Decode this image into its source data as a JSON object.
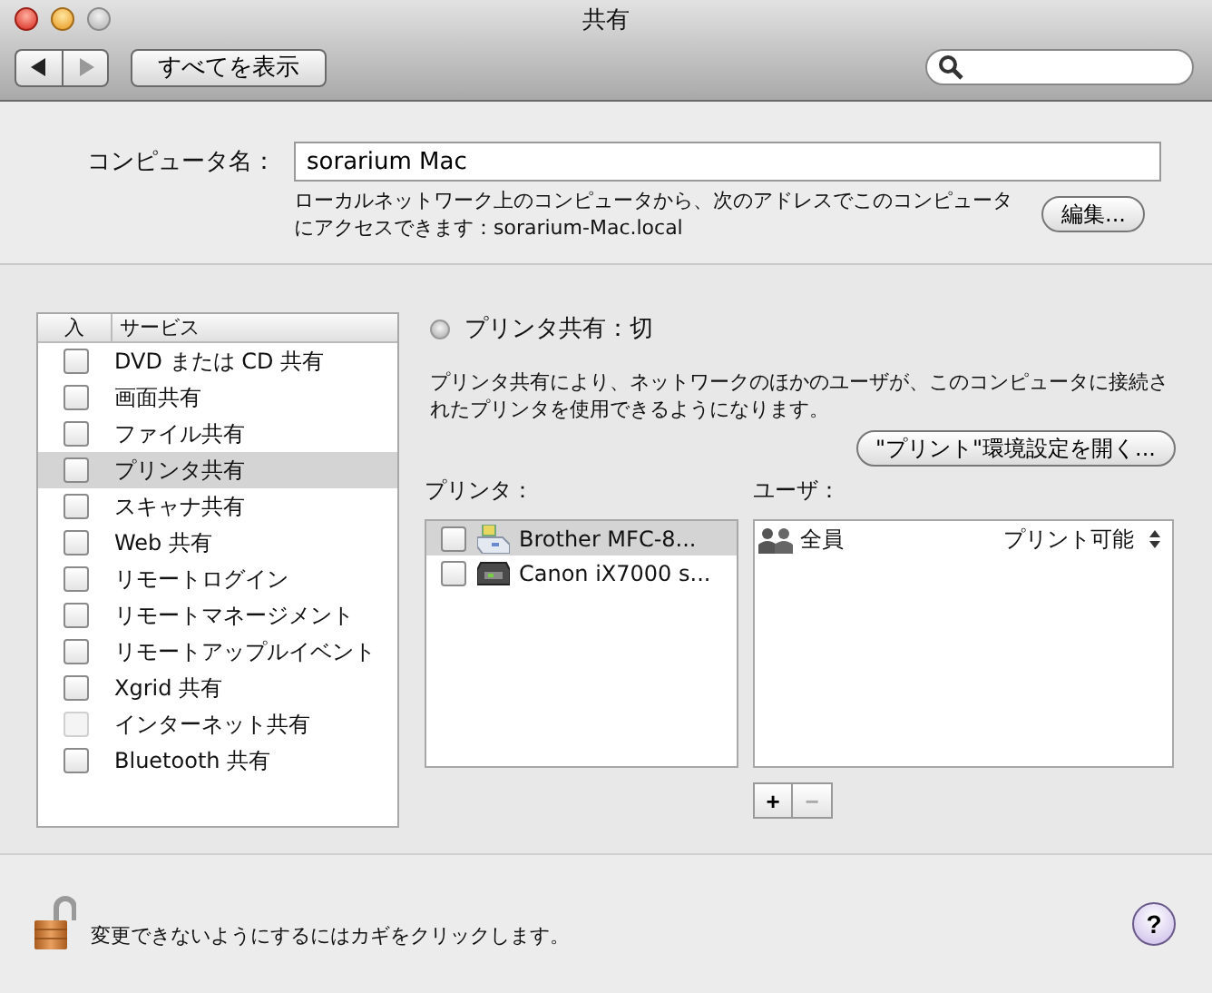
{
  "window": {
    "title": "共有"
  },
  "toolbar": {
    "show_all": "すべてを表示"
  },
  "computer_name": {
    "label": "コンピュータ名：",
    "value": "sorarium Mac",
    "description": "ローカルネットワーク上のコンピュータから、次のアドレスでこのコンピュータにアクセスできます：sorarium-Mac.local",
    "edit_button": "編集..."
  },
  "services": {
    "columns": [
      "入",
      "サービス"
    ],
    "items": [
      {
        "name": "DVD または CD 共有",
        "checked": false,
        "selected": false,
        "disabled": false
      },
      {
        "name": "画面共有",
        "checked": false,
        "selected": false,
        "disabled": false
      },
      {
        "name": "ファイル共有",
        "checked": false,
        "selected": false,
        "disabled": false
      },
      {
        "name": "プリンタ共有",
        "checked": false,
        "selected": true,
        "disabled": false
      },
      {
        "name": "スキャナ共有",
        "checked": false,
        "selected": false,
        "disabled": false
      },
      {
        "name": "Web 共有",
        "checked": false,
        "selected": false,
        "disabled": false
      },
      {
        "name": "リモートログイン",
        "checked": false,
        "selected": false,
        "disabled": false
      },
      {
        "name": "リモートマネージメント",
        "checked": false,
        "selected": false,
        "disabled": false
      },
      {
        "name": "リモートアップルイベント",
        "checked": false,
        "selected": false,
        "disabled": false
      },
      {
        "name": "Xgrid 共有",
        "checked": false,
        "selected": false,
        "disabled": false
      },
      {
        "name": "インターネット共有",
        "checked": false,
        "selected": false,
        "disabled": true
      },
      {
        "name": "Bluetooth 共有",
        "checked": false,
        "selected": false,
        "disabled": false
      }
    ]
  },
  "detail": {
    "status": {
      "label": "プリンタ共有：切",
      "on": false
    },
    "description": "プリンタ共有により、ネットワークのほかのユーザが、このコンピュータに接続されたプリンタを使用できるようになります。",
    "open_prefs_button": "\"プリント\"環境設定を開く...",
    "printers_label": "プリンタ：",
    "printers": [
      {
        "name": "Brother MFC-8...",
        "kind": "laser",
        "checked": false,
        "selected": true
      },
      {
        "name": "Canon iX7000 s...",
        "kind": "inkjet",
        "checked": false,
        "selected": false
      }
    ],
    "users_label": "ユーザ：",
    "users": [
      {
        "name": "全員",
        "permission": "プリント可能"
      }
    ],
    "add_button": "+",
    "remove_button": "−"
  },
  "footer": {
    "lock_text": "変更できないようにするにはカギをクリックします。",
    "locked": false,
    "help": "?"
  }
}
